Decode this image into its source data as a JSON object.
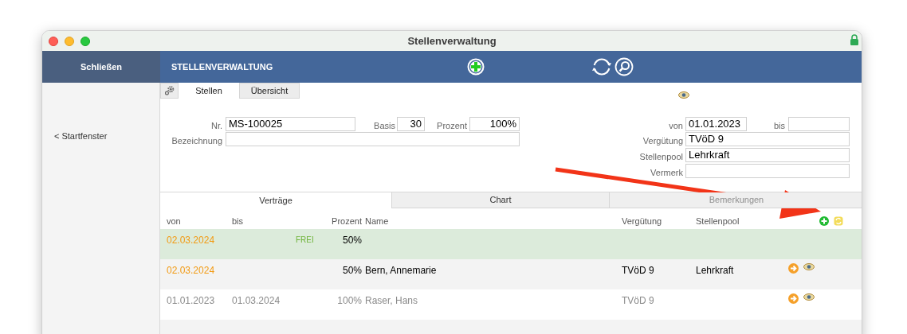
{
  "window": {
    "title": "Stellenverwaltung"
  },
  "toolbar": {
    "close_button": "Schließen",
    "title": "STELLENVERWALTUNG"
  },
  "sidebar": {
    "items": [
      {
        "label": "< Startfenster"
      }
    ]
  },
  "tabs": [
    {
      "label": "Stellen",
      "selected": true
    },
    {
      "label": "Übersicht",
      "selected": false
    }
  ],
  "form": {
    "nr": {
      "label": "Nr.",
      "value": "MS-100025"
    },
    "basis": {
      "label": "Basis",
      "value": "30"
    },
    "prozent": {
      "label": "Prozent",
      "value": "100%"
    },
    "bezeichnung": {
      "label": "Bezeichnung"
    },
    "von": {
      "label": "von",
      "value": "01.01.2023"
    },
    "bis": {
      "label": "bis"
    },
    "verguetung": {
      "label": "Vergütung",
      "value": "TVöD 9"
    },
    "stellenpool": {
      "label": "Stellenpool",
      "value": "Lehrkraft"
    },
    "vermerk": {
      "label": "Vermerk"
    }
  },
  "subtabs": [
    {
      "label": "Verträge",
      "selected": true,
      "disabled": false
    },
    {
      "label": "Chart",
      "selected": false,
      "disabled": false
    },
    {
      "label": "Bemerkungen",
      "selected": false,
      "disabled": true
    }
  ],
  "contracts": {
    "columns": [
      "von",
      "bis",
      "Prozent",
      "Name",
      "Vergütung",
      "Stellenpool"
    ],
    "rows": [
      {
        "kind": "free",
        "von": "02.03.2024",
        "status": "FREI",
        "prozent": "50%",
        "has_actions": false
      },
      {
        "kind": "current",
        "von": "02.03.2024",
        "prozent": "50%",
        "name": "Bern, Annemarie",
        "verguetung": "TVöD 9",
        "stellenpool": "Lehrkraft",
        "has_actions": true
      },
      {
        "kind": "past",
        "von": "01.01.2023",
        "bis": "01.03.2024",
        "prozent": "100%",
        "name": "Raser, Hans",
        "verguetung": "TVöD 9",
        "has_actions": true
      }
    ]
  }
}
